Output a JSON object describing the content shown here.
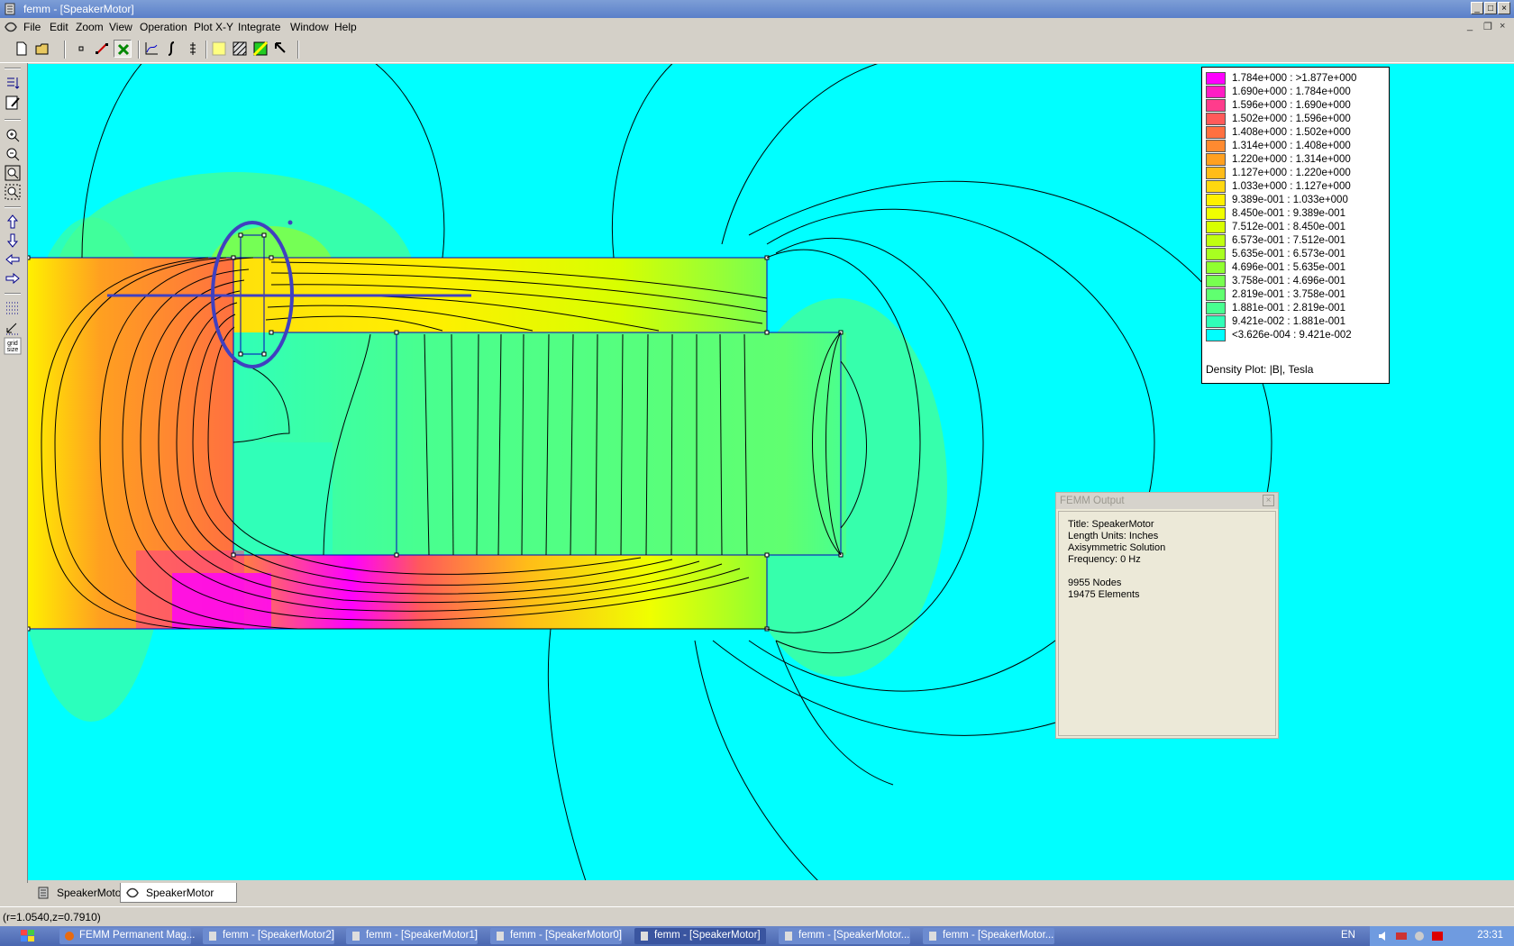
{
  "window": {
    "title": "femm - [SpeakerMotor]"
  },
  "menu": [
    "File",
    "Edit",
    "Zoom",
    "View",
    "Operation",
    "Plot X-Y",
    "Integrate",
    "Window",
    "Help"
  ],
  "legend": {
    "rows": [
      {
        "label": "1.784e+000 : >1.877e+000",
        "color": "#ff00ff"
      },
      {
        "label": "1.690e+000 : 1.784e+000",
        "color": "#ff1dc4"
      },
      {
        "label": "1.596e+000 : 1.690e+000",
        "color": "#ff3c8c"
      },
      {
        "label": "1.502e+000 : 1.596e+000",
        "color": "#ff5a5a"
      },
      {
        "label": "1.408e+000 : 1.502e+000",
        "color": "#ff7040"
      },
      {
        "label": "1.314e+000 : 1.408e+000",
        "color": "#ff8a30"
      },
      {
        "label": "1.220e+000 : 1.314e+000",
        "color": "#ffa020"
      },
      {
        "label": "1.127e+000 : 1.220e+000",
        "color": "#ffbc18"
      },
      {
        "label": "1.033e+000 : 1.127e+000",
        "color": "#ffd810"
      },
      {
        "label": "9.389e-001 : 1.033e+000",
        "color": "#fff000"
      },
      {
        "label": "8.450e-001 : 9.389e-001",
        "color": "#f0ff00"
      },
      {
        "label": "7.512e-001 : 8.450e-001",
        "color": "#d8ff00"
      },
      {
        "label": "6.573e-001 : 7.512e-001",
        "color": "#c0ff10"
      },
      {
        "label": "5.635e-001 : 6.573e-001",
        "color": "#a8ff20"
      },
      {
        "label": "4.696e-001 : 5.635e-001",
        "color": "#90ff30"
      },
      {
        "label": "3.758e-001 : 4.696e-001",
        "color": "#78ff50"
      },
      {
        "label": "2.819e-001 : 3.758e-001",
        "color": "#60ff70"
      },
      {
        "label": "1.881e-001 : 2.819e-001",
        "color": "#48ff90"
      },
      {
        "label": "9.421e-002 : 1.881e-001",
        "color": "#30ffb8"
      },
      {
        "label": "<3.626e-004 : 9.421e-002",
        "color": "#00ffff"
      }
    ],
    "caption": "Density Plot: |B|, Tesla"
  },
  "output": {
    "title": "FEMM Output",
    "lines": [
      "Title: SpeakerMotor",
      "Length Units: Inches",
      "Axisymmetric Solution",
      "Frequency: 0 Hz",
      "",
      "9955 Nodes",
      "19475 Elements"
    ]
  },
  "tabs": [
    "SpeakerMotor",
    "SpeakerMotor"
  ],
  "status": "(r=1.0540,z=0.7910)",
  "taskbar": {
    "items": [
      "FEMM Permanent Mag...",
      "femm - [SpeakerMotor2]",
      "femm - [SpeakerMotor1]",
      "femm - [SpeakerMotor0]",
      "femm - [SpeakerMotor]",
      "femm - [SpeakerMotor...",
      "femm - [SpeakerMotor..."
    ],
    "lang": "EN",
    "clock": "23:31"
  },
  "icons": {
    "toolbar": [
      "new-file-icon",
      "open-folder-icon",
      "node-mode-icon",
      "segment-mode-icon",
      "block-mode-icon",
      "plot-xy-icon",
      "integrate-icon",
      "line-integral-icon",
      "show-mesh-icon",
      "density-plot-icon",
      "vector-plot-icon",
      "arrow-select-icon"
    ],
    "left": [
      "smart-mesh-icon",
      "edit-props-icon",
      "zoom-in-icon",
      "zoom-out-icon",
      "zoom-fit-icon",
      "zoom-window-icon",
      "pan-up-icon",
      "pan-down-icon",
      "pan-left-icon",
      "pan-right-icon",
      "show-grid-icon",
      "snap-grid-icon",
      "grid-size-icon"
    ]
  }
}
